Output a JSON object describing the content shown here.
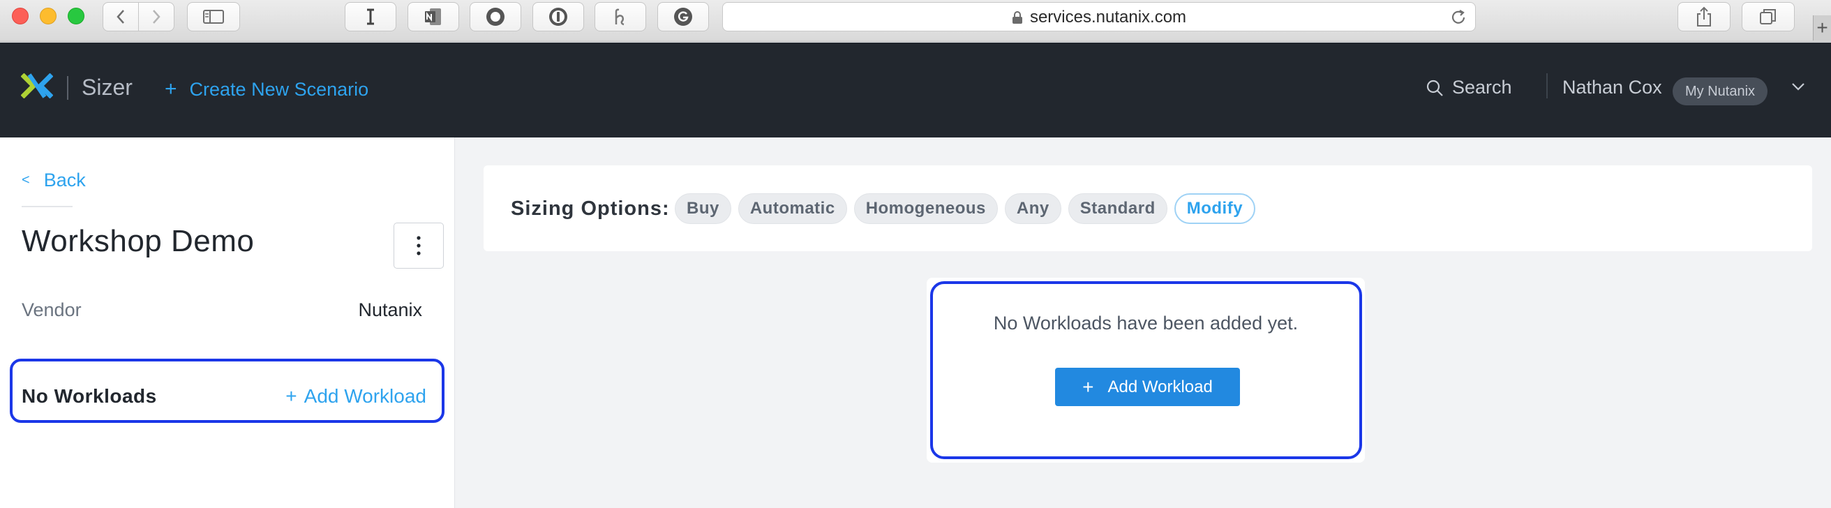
{
  "browser": {
    "url": "services.nutanix.com",
    "toolbar_icons": [
      "reader-i-icon",
      "onenote-icon",
      "record-icon",
      "onepassword-icon",
      "honey-icon",
      "grammarly-icon"
    ]
  },
  "header": {
    "product": "Sizer",
    "create_label": "Create New Scenario",
    "search_label": "Search",
    "user_name": "Nathan Cox",
    "my_nutanix_label": "My Nutanix",
    "accent_color": "#2ea3ee",
    "logo_colors": [
      "#afd235",
      "#2ea3ee"
    ]
  },
  "sidebar": {
    "back_label": "Back",
    "scenario_title": "Workshop Demo",
    "vendor_label": "Vendor",
    "vendor_value": "Nutanix",
    "workloads_label": "No Workloads",
    "add_workload_label": "Add Workload"
  },
  "sizing_options": {
    "label": "Sizing Options:",
    "chips": [
      "Buy",
      "Automatic",
      "Homogeneous",
      "Any",
      "Standard"
    ],
    "modify_label": "Modify"
  },
  "empty_state": {
    "message": "No Workloads have been added yet.",
    "button_label": "Add Workload",
    "button_color": "#2289e0"
  },
  "highlight_color": "#1b37e8"
}
